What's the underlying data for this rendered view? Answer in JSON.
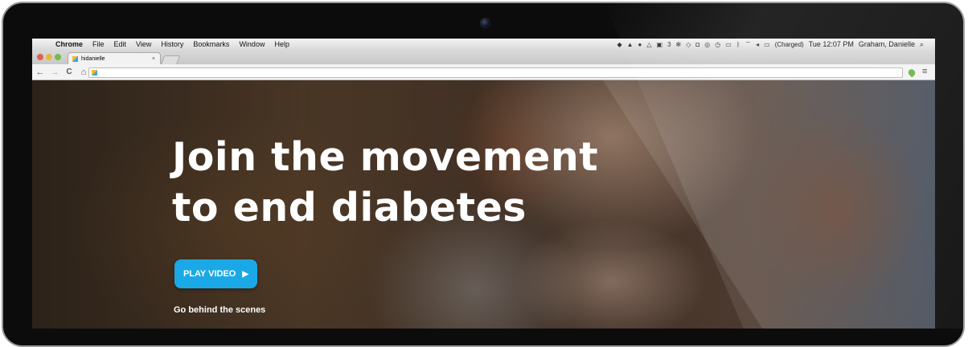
{
  "menubar": {
    "apple_glyph": "",
    "items": [
      "Chrome",
      "File",
      "Edit",
      "View",
      "History",
      "Bookmarks",
      "Window",
      "Help"
    ],
    "tray_count": "3",
    "battery": "(Charged)",
    "clock": "Tue 12:07 PM",
    "user": "Graham, Danielle",
    "search_glyph": "⌕"
  },
  "browser": {
    "tab_title": "hidanielle",
    "tab_close": "×",
    "back": "←",
    "forward": "→",
    "reload": "C",
    "home": "⌂",
    "menu": "≡",
    "url": ""
  },
  "hero": {
    "headline_line1": "Join the movement",
    "headline_line2": "to end diabetes",
    "play_label": "PLAY VIDEO",
    "play_icon": "▶",
    "subtext": "Go behind the scenes",
    "accent_color": "#1aa9e6"
  }
}
